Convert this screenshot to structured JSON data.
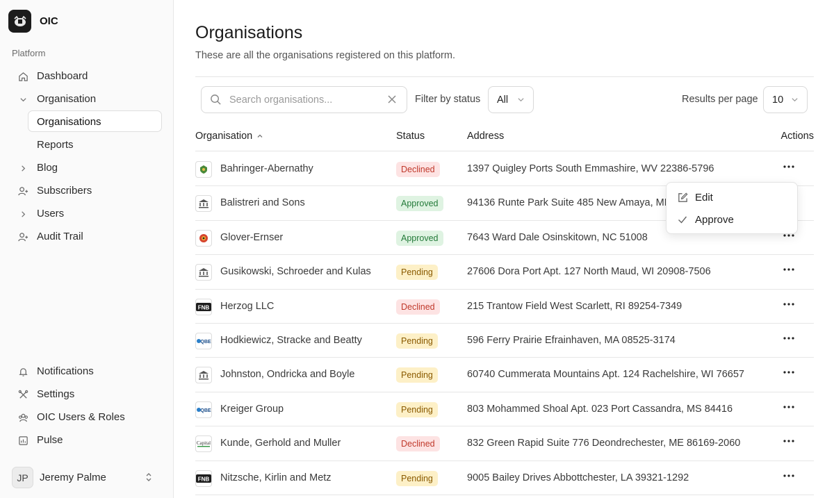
{
  "app": {
    "name": "OIC",
    "logo_icon": "crest-logo-icon"
  },
  "sidebar": {
    "section_label": "Platform",
    "items": [
      {
        "label": "Dashboard",
        "icon": "home-icon"
      },
      {
        "label": "Organisation",
        "icon": "chevron-down-icon"
      },
      {
        "label": "Blog",
        "icon": "chevron-right-icon"
      },
      {
        "label": "Subscribers",
        "icon": "user-plus-icon"
      },
      {
        "label": "Users",
        "icon": "chevron-right-icon"
      },
      {
        "label": "Audit Trail",
        "icon": "user-plus-icon"
      }
    ],
    "sub_items": [
      {
        "label": "Organisations",
        "active": true
      },
      {
        "label": "Reports",
        "active": false
      }
    ],
    "bottom_items": [
      {
        "label": "Notifications",
        "icon": "bell-icon"
      },
      {
        "label": "Settings",
        "icon": "tools-icon"
      },
      {
        "label": "OIC Users & Roles",
        "icon": "users-icon"
      },
      {
        "label": "Pulse",
        "icon": "chart-icon"
      }
    ],
    "user": {
      "initials": "JP",
      "name": "Jeremy Palme"
    }
  },
  "page": {
    "title": "Organisations",
    "subtitle": "These are all the organisations registered on this platform."
  },
  "toolbar": {
    "search_placeholder": "Search organisations...",
    "filter_label": "Filter by status",
    "filter_value": "All",
    "results_label": "Results per page",
    "results_value": "10"
  },
  "table": {
    "headers": {
      "organisation": "Organisation",
      "status": "Status",
      "address": "Address",
      "actions": "Actions"
    },
    "sort_column": "organisation",
    "sort_direction": "asc",
    "rows": [
      {
        "name": "Bahringer-Abernathy",
        "status": "Declined",
        "status_key": "declined",
        "address": "1397 Quigley Ports South Emmashire, WV 22386-5796",
        "logo": "crest"
      },
      {
        "name": "Balistreri and Sons",
        "status": "Approved",
        "status_key": "approved",
        "address": "94136 Runte Park Suite 485 New Amaya, MD 1",
        "logo": "bank"
      },
      {
        "name": "Glover-Ernser",
        "status": "Approved",
        "status_key": "approved",
        "address": "7643 Ward Dale Osinskitown, NC 51008",
        "logo": "flower"
      },
      {
        "name": "Gusikowski, Schroeder and Kulas",
        "status": "Pending",
        "status_key": "pending",
        "address": "27606 Dora Port Apt. 127 North Maud, WI 20908-7506",
        "logo": "bank"
      },
      {
        "name": "Herzog LLC",
        "status": "Declined",
        "status_key": "declined",
        "address": "215 Trantow Field West Scarlett, RI 89254-7349",
        "logo": "fnb"
      },
      {
        "name": "Hodkiewicz, Stracke and Beatty",
        "status": "Pending",
        "status_key": "pending",
        "address": "596 Ferry Prairie Efrainhaven, MA 08525-3174",
        "logo": "qbe"
      },
      {
        "name": "Johnston, Ondricka and Boyle",
        "status": "Pending",
        "status_key": "pending",
        "address": "60740 Cummerata Mountains Apt. 124 Rachelshire, WI 76657",
        "logo": "bank"
      },
      {
        "name": "Kreiger Group",
        "status": "Pending",
        "status_key": "pending",
        "address": "803 Mohammed Shoal Apt. 023 Port Cassandra, MS 84416",
        "logo": "qbe"
      },
      {
        "name": "Kunde, Gerhold and Muller",
        "status": "Declined",
        "status_key": "declined",
        "address": "832 Green Rapid Suite 776 Deondrechester, ME 86169-2060",
        "logo": "capital"
      },
      {
        "name": "Nitzsche, Kirlin and Metz",
        "status": "Pending",
        "status_key": "pending",
        "address": "9005 Bailey Drives Abbottchester, LA 39321-1292",
        "logo": "fnb"
      }
    ]
  },
  "context_menu": {
    "items": [
      {
        "label": "Edit",
        "icon": "edit-icon"
      },
      {
        "label": "Approve",
        "icon": "check-icon"
      }
    ]
  }
}
